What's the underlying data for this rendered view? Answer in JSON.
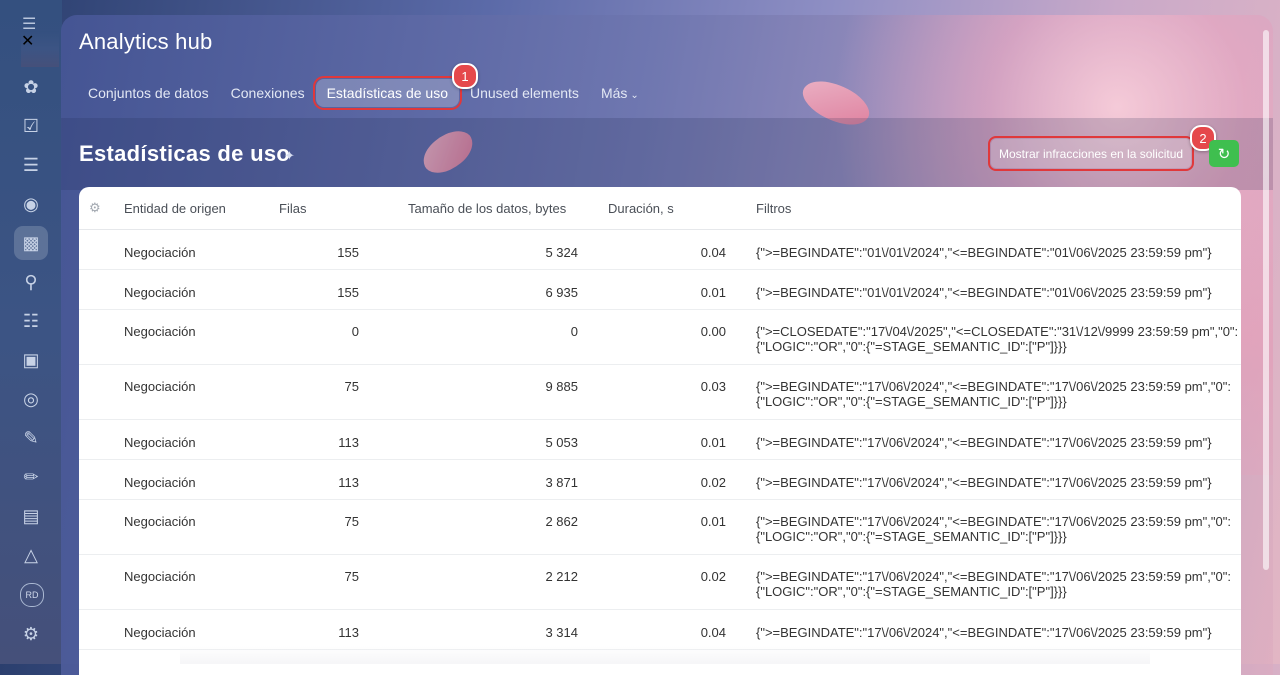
{
  "app": {
    "title": "Analytics hub"
  },
  "rail": {
    "avatar": "RD"
  },
  "tabs": [
    {
      "label": "Conjuntos de datos"
    },
    {
      "label": "Conexiones"
    },
    {
      "label": "Estadísticas de uso"
    },
    {
      "label": "Unused elements"
    },
    {
      "label": "Más"
    }
  ],
  "badges": {
    "one": "1",
    "two": "2"
  },
  "page": {
    "title": "Estadísticas de uso",
    "violations_button": "Mostrar infracciones en la solicitud"
  },
  "table": {
    "headers": {
      "entity": "Entidad de origen",
      "rows": "Filas",
      "size": "Tamaño de los datos, bytes",
      "duration": "Duración, s",
      "filters": "Filtros"
    },
    "rows": [
      {
        "entity": "Negociación",
        "rows": "155",
        "size": "5 324",
        "duration": "0.04",
        "filter1": "{\">=BEGINDATE\":\"01\\/01\\/2024\",\"<=BEGINDATE\":\"01\\/06\\/2025 23:59:59 pm\"}",
        "filter2": ""
      },
      {
        "entity": "Negociación",
        "rows": "155",
        "size": "6 935",
        "duration": "0.01",
        "filter1": "{\">=BEGINDATE\":\"01\\/01\\/2024\",\"<=BEGINDATE\":\"01\\/06\\/2025 23:59:59 pm\"}",
        "filter2": ""
      },
      {
        "entity": "Negociación",
        "rows": "0",
        "size": "0",
        "duration": "0.00",
        "filter1": "{\">=CLOSEDATE\":\"17\\/04\\/2025\",\"<=CLOSEDATE\":\"31\\/12\\/9999 23:59:59 pm\",\"0\":",
        "filter2": "{\"LOGIC\":\"OR\",\"0\":{\"=STAGE_SEMANTIC_ID\":[\"P\"]}}}"
      },
      {
        "entity": "Negociación",
        "rows": "75",
        "size": "9 885",
        "duration": "0.03",
        "filter1": "{\">=BEGINDATE\":\"17\\/06\\/2024\",\"<=BEGINDATE\":\"17\\/06\\/2025 23:59:59 pm\",\"0\":",
        "filter2": "{\"LOGIC\":\"OR\",\"0\":{\"=STAGE_SEMANTIC_ID\":[\"P\"]}}}"
      },
      {
        "entity": "Negociación",
        "rows": "113",
        "size": "5 053",
        "duration": "0.01",
        "filter1": "{\">=BEGINDATE\":\"17\\/06\\/2024\",\"<=BEGINDATE\":\"17\\/06\\/2025 23:59:59 pm\"}",
        "filter2": ""
      },
      {
        "entity": "Negociación",
        "rows": "113",
        "size": "3 871",
        "duration": "0.02",
        "filter1": "{\">=BEGINDATE\":\"17\\/06\\/2024\",\"<=BEGINDATE\":\"17\\/06\\/2025 23:59:59 pm\"}",
        "filter2": ""
      },
      {
        "entity": "Negociación",
        "rows": "75",
        "size": "2 862",
        "duration": "0.01",
        "filter1": "{\">=BEGINDATE\":\"17\\/06\\/2024\",\"<=BEGINDATE\":\"17\\/06\\/2025 23:59:59 pm\",\"0\":",
        "filter2": "{\"LOGIC\":\"OR\",\"0\":{\"=STAGE_SEMANTIC_ID\":[\"P\"]}}}"
      },
      {
        "entity": "Negociación",
        "rows": "75",
        "size": "2 212",
        "duration": "0.02",
        "filter1": "{\">=BEGINDATE\":\"17\\/06\\/2024\",\"<=BEGINDATE\":\"17\\/06\\/2025 23:59:59 pm\",\"0\":",
        "filter2": "{\"LOGIC\":\"OR\",\"0\":{\"=STAGE_SEMANTIC_ID\":[\"P\"]}}}"
      },
      {
        "entity": "Negociación",
        "rows": "113",
        "size": "3 314",
        "duration": "0.04",
        "filter1": "{\">=BEGINDATE\":\"17\\/06\\/2024\",\"<=BEGINDATE\":\"17\\/06\\/2025 23:59:59 pm\"}",
        "filter2": ""
      }
    ]
  },
  "colors": {
    "accent": "#2fa8e6",
    "highlight": "#e0383b",
    "refresh": "#3fbf4f"
  }
}
